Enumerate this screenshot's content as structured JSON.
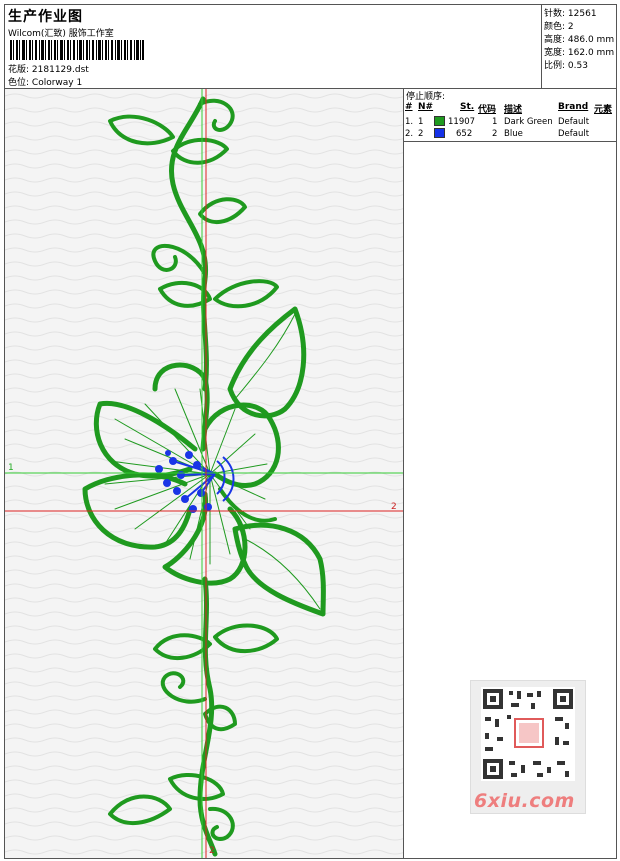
{
  "header": {
    "title": "生产作业图",
    "company": "Wilcom(汇致) 服饰工作室",
    "design_label": "花版:",
    "design_value": "2181129.dst",
    "color_label": "色位:",
    "color_value": "Colorway 1"
  },
  "stats": {
    "stitches": {
      "label": "针数:",
      "value": "12561"
    },
    "colors": {
      "label": "颜色:",
      "value": "2"
    },
    "height": {
      "label": "高度:",
      "value": "486.0 mm"
    },
    "width": {
      "label": "宽度:",
      "value": "162.0 mm"
    },
    "scale": {
      "label": "比例:",
      "value": "0.53"
    }
  },
  "stop_sequence": {
    "title": "停止顺序:",
    "headers": [
      "#",
      "N#",
      "St.",
      "代码",
      "描述",
      "Brand",
      "元素"
    ],
    "rows": [
      {
        "idx": "1.",
        "n": "1",
        "stitches": "11907",
        "code": "1",
        "desc": "Dark Green",
        "brand": "Default",
        "color": "#1f9a1f"
      },
      {
        "idx": "2.",
        "n": "2",
        "stitches": "652",
        "code": "2",
        "desc": "Blue",
        "brand": "Default",
        "color": "#1531e8"
      }
    ]
  },
  "canvas": {
    "axis_label_h1": "1",
    "axis_label_h2": "2",
    "axis_label_v2": "2",
    "thread_green": "#1f9a1f",
    "thread_blue": "#1a35e6",
    "guide_green": "#33cc33",
    "guide_red": "#dd2222"
  },
  "watermark": "6xiu.com"
}
